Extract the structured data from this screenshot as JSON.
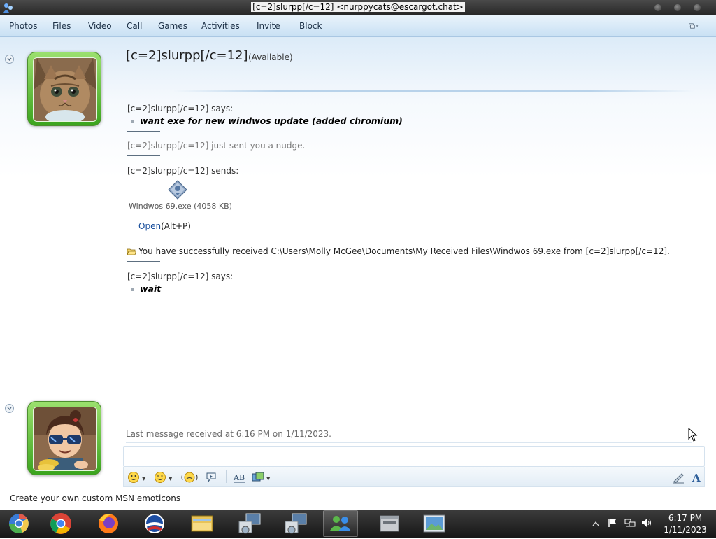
{
  "window": {
    "title": "[c=2]slurpp[/c=12] <nurppycats@escargot.chat>"
  },
  "menu": {
    "items": [
      "Photos",
      "Files",
      "Video",
      "Call",
      "Games",
      "Activities",
      "Invite",
      "Block"
    ]
  },
  "contact": {
    "name": "[c=2]slurpp[/c=12]",
    "status": "(Available)"
  },
  "messages": {
    "m1_header": "[c=2]slurpp[/c=12] says:",
    "m1_text": "want exe for new windwos update (added chromium)",
    "nudge": "[c=2]slurpp[/c=12] just sent you a nudge.",
    "send_header": "[c=2]slurpp[/c=12] sends:",
    "file_name": "Windwos 69.exe (4058 KB)",
    "open_label": "Open",
    "open_shortcut": "(Alt+P)",
    "received": "You have successfully received C:\\Users\\Molly McGee\\Documents\\My Received Files\\Windwos 69.exe from [c=2]slurpp[/c=12].",
    "m2_header": "[c=2]slurpp[/c=12] says:",
    "m2_text": "wait"
  },
  "footer": {
    "last_message": "Last message received at 6:16 PM on 1/11/2023.",
    "status_bar": "Create your own custom MSN emoticons"
  },
  "toolbar_icons": [
    "emoticon-icon",
    "wink-icon",
    "nudge-icon",
    "voice-clip-icon",
    "font-icon",
    "background-icon",
    "handwriting-icon",
    "text-format-icon"
  ],
  "taskbar": {
    "apps": [
      "chromium-icon",
      "chrome-icon",
      "firefox-icon",
      "obama-logo-icon",
      "file-explorer-icon",
      "network-setup-icon",
      "network-setup-icon-2",
      "messenger-icon",
      "archive-icon",
      "image-viewer-icon"
    ],
    "time": "6:17 PM",
    "date": "1/11/2023"
  },
  "colors": {
    "avatar_frame": "#5cc236",
    "link": "#1a4f9c",
    "menubar": "#d6e8f7"
  }
}
